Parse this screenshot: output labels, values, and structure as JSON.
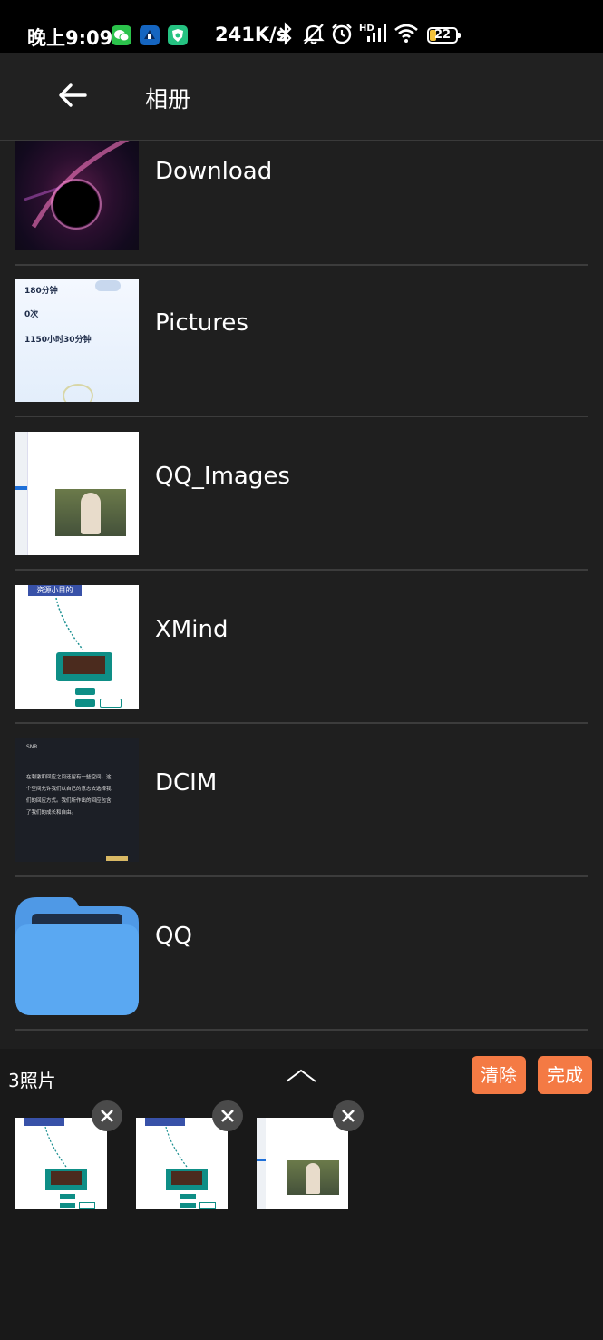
{
  "status_bar": {
    "time": "晚上9:09",
    "network_speed": "241K/s",
    "battery_level": "22",
    "hd_label": "HD",
    "icons": [
      "wechat-icon",
      "app-icon",
      "shield-app-icon",
      "bluetooth-icon",
      "mute-icon",
      "alarm-icon",
      "signal-icon",
      "wifi-icon",
      "battery-icon"
    ]
  },
  "header": {
    "title": "相册",
    "back_icon": "back-arrow-icon"
  },
  "albums": [
    {
      "name": "Download"
    },
    {
      "name": "Pictures"
    },
    {
      "name": "QQ_Images"
    },
    {
      "name": "XMind"
    },
    {
      "name": "DCIM"
    },
    {
      "name": "QQ"
    }
  ],
  "thumb_text": {
    "pictures": [
      "180分钟",
      "0次",
      "1150小时30分钟"
    ],
    "xmind_banner": "资源小目的",
    "dcim_title": "SNR",
    "dcim_lines": [
      "在刺激和回应之间还留有一些空间。这",
      "个空间允许我们以自己的意志去选择我",
      "们的回应方式。我们所作出的回应包含",
      "了我们的成长和自由。"
    ]
  },
  "selection": {
    "count_label": "3照片",
    "clear_label": "清除",
    "done_label": "完成"
  },
  "colors": {
    "background": "#1f1f1f",
    "accent": "#f47a44",
    "folder": "#5aa8f2",
    "divider": "#3c3c3c"
  }
}
